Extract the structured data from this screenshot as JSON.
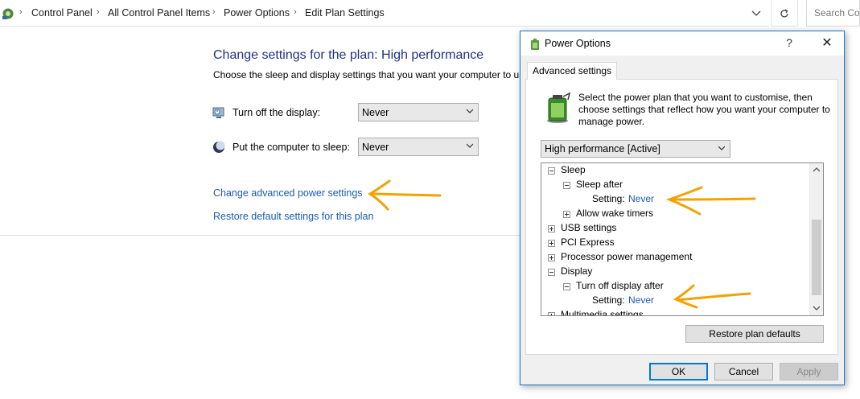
{
  "address_bar": {
    "breadcrumbs": [
      "Control Panel",
      "All Control Panel Items",
      "Power Options",
      "Edit Plan Settings"
    ],
    "search_placeholder": "Search Cor"
  },
  "main": {
    "title": "Change settings for the plan: High performance",
    "description": "Choose the sleep and display settings that you want your computer to use.",
    "settings": [
      {
        "label": "Turn off the display:",
        "value": "Never",
        "icon": "monitor-icon"
      },
      {
        "label": "Put the computer to sleep:",
        "value": "Never",
        "icon": "moon-icon"
      }
    ],
    "links": {
      "advanced": "Change advanced power settings",
      "restore": "Restore default settings for this plan"
    }
  },
  "dialog": {
    "title": "Power Options",
    "help": "?",
    "close": "✕",
    "tab": "Advanced settings",
    "description": "Select the power plan that you want to customise, then choose settings that reflect how you want your computer to manage power.",
    "plan_select": "High performance [Active]",
    "tree": {
      "sleep": "Sleep",
      "sleep_after": "Sleep after",
      "sleep_setting_label": "Setting:",
      "sleep_setting_value": "Never",
      "allow_wake": "Allow wake timers",
      "usb": "USB settings",
      "pci": "PCI Express",
      "processor": "Processor power management",
      "display": "Display",
      "display_off_after": "Turn off display after",
      "display_setting_label": "Setting:",
      "display_setting_value": "Never",
      "multimedia": "Multimedia settings"
    },
    "buttons": {
      "restore": "Restore plan defaults",
      "ok": "OK",
      "cancel": "Cancel",
      "apply": "Apply"
    }
  },
  "colors": {
    "title_blue": "#1e3287",
    "link_blue": "#1a5cb4",
    "annotation_arrow": "#f5a100",
    "dialog_border": "#1979ca"
  }
}
